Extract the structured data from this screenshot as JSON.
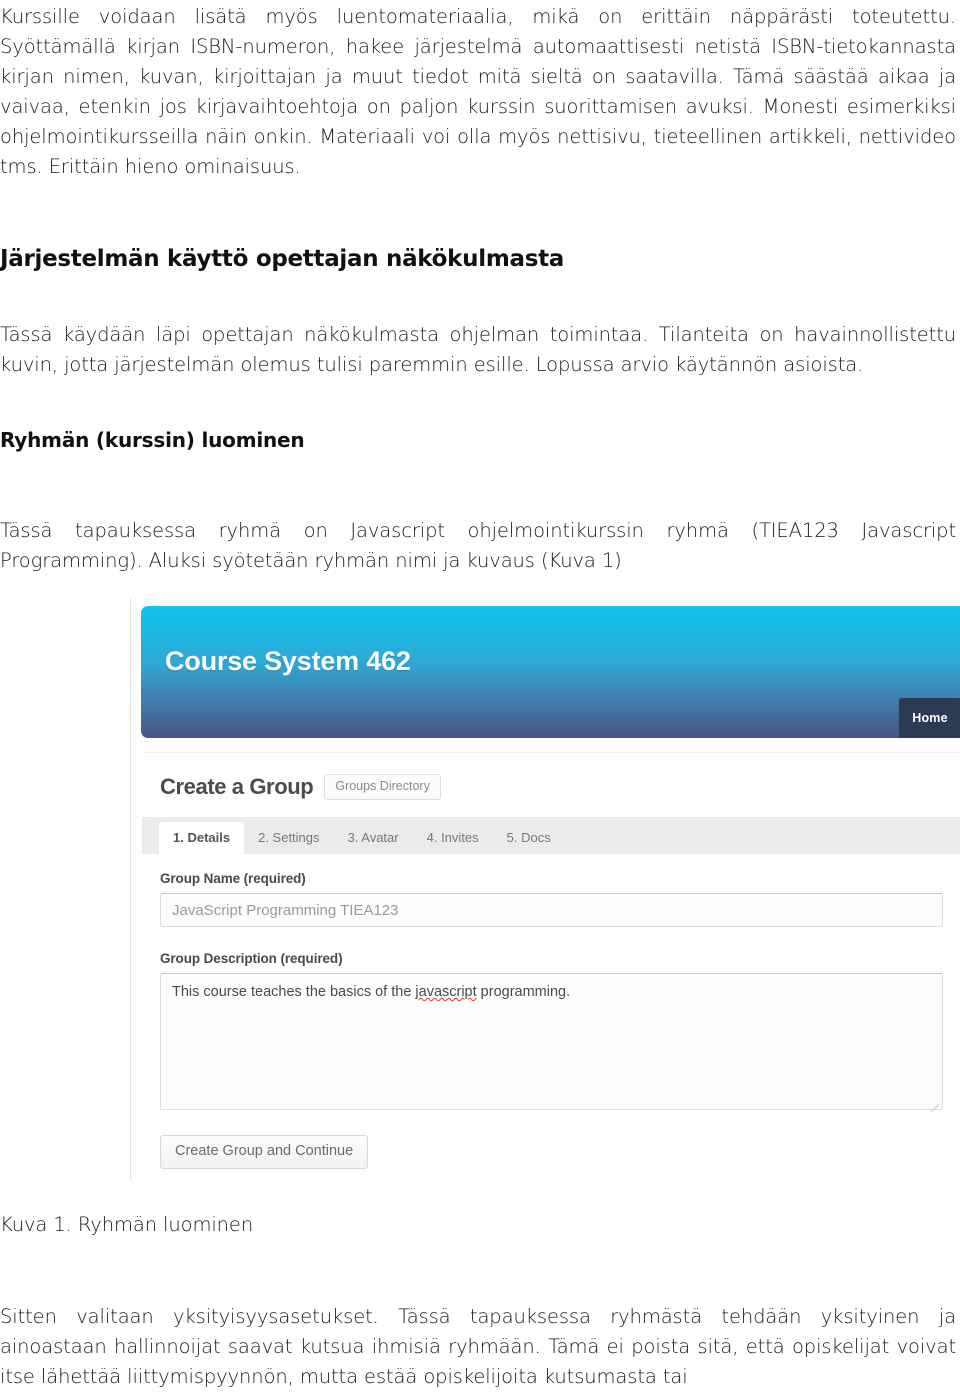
{
  "document": {
    "intro_paragraph": "Kurssille voidaan lisätä myös luentomateriaalia, mikä on erittäin näppärästi toteutettu. Syöttämällä kirjan ISBN-numeron, hakee järjestelmä automaattisesti netistä ISBN-tietokannasta kirjan nimen, kuvan, kirjoittajan ja muut tiedot mitä sieltä on saatavilla. Tämä säästää aikaa ja vaivaa, etenkin jos kirjavaihtoehtoja on paljon kurssin suorittamisen avuksi. Monesti esimerkiksi ohjelmointikursseilla näin onkin. Materiaali voi olla myös nettisivu, tieteellinen artikkeli, nettivideo tms. Erittäin hieno ominaisuus.",
    "section_heading": "Järjestelmän käyttö opettajan näkökulmasta",
    "section_paragraph": "Tässä käydään läpi opettajan näkökulmasta ohjelman toimintaa. Tilanteita on havainnollistettu kuvin, jotta järjestelmän olemus tulisi paremmin esille. Lopussa arvio käytännön asioista.",
    "sub_heading": "Ryhmän (kurssin) luominen",
    "sub_paragraph": "Tässä tapauksessa ryhmä on Javascript ohjelmointikurssin ryhmä (TIEA123 Javascript Programming). Aluksi syötetään ryhmän nimi ja kuvaus (Kuva 1)",
    "figure_caption": "Kuva 1. Ryhmän luominen",
    "closing_paragraph": "Sitten valitaan yksityisyysasetukset. Tässä tapauksessa ryhmästä tehdään yksityinen ja ainoastaan hallinnoijat saavat kutsua ihmisiä ryhmään. Tämä ei poista sitä, että opiskelijat voivat itse lähettää liittymispyynnön, mutta estää opiskelijoita kutsumasta tai"
  },
  "screenshot": {
    "hero": {
      "site_title": "Course System 462",
      "home_button": "Home",
      "gradient_top": "#19c2ea",
      "gradient_bottom": "#4a5584",
      "home_button_color": "#2b3c52"
    },
    "page_title": "Create a Group",
    "directory_button": "Groups Directory",
    "tabs": [
      {
        "label": "1. Details",
        "active": true
      },
      {
        "label": "2. Settings",
        "active": false
      },
      {
        "label": "3. Avatar",
        "active": false
      },
      {
        "label": "4. Invites",
        "active": false
      },
      {
        "label": "5. Docs",
        "active": false
      }
    ],
    "form": {
      "group_name_label": "Group Name (required)",
      "group_name_value": "JavaScript Programming TIEA123",
      "group_description_label": "Group Description (required)",
      "group_description_value_pre": "This course teaches the basics of the ",
      "group_description_misspelled": "javascript",
      "group_description_value_post": " programming.",
      "submit_button": "Create Group and Continue"
    }
  }
}
